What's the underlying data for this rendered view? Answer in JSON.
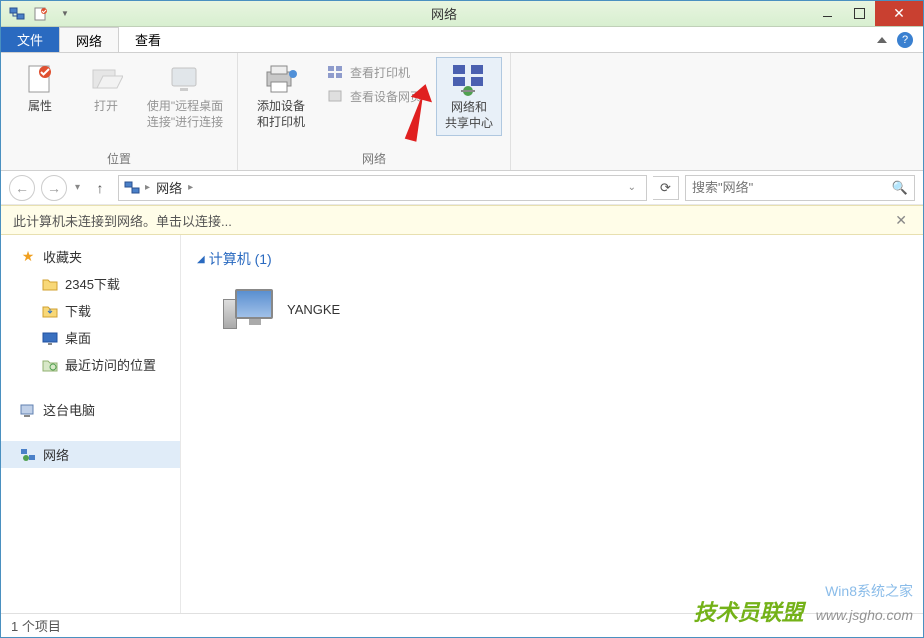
{
  "window": {
    "title": "网络",
    "close_glyph": "✕"
  },
  "tabs": {
    "file": "文件",
    "network": "网络",
    "view": "查看"
  },
  "ribbon": {
    "group_location": "位置",
    "group_network": "网络",
    "btn_properties": "属性",
    "btn_open": "打开",
    "btn_rdp_line1": "使用\"远程桌面",
    "btn_rdp_line2": "连接\"进行连接",
    "btn_add_devices_line1": "添加设备",
    "btn_add_devices_line2": "和打印机",
    "btn_view_printers": "查看打印机",
    "btn_view_device_page": "查看设备网页",
    "btn_sharing_center_line1": "网络和",
    "btn_sharing_center_line2": "共享中心"
  },
  "address": {
    "root": "网络",
    "search_placeholder": "搜索\"网络\""
  },
  "notification": {
    "text": "此计算机未连接到网络。单击以连接...",
    "close": "✕"
  },
  "sidebar": {
    "favorites": "收藏夹",
    "downloads2345": "2345下载",
    "downloads": "下载",
    "desktop": "桌面",
    "recent": "最近访问的位置",
    "thispc": "这台电脑",
    "network": "网络"
  },
  "content": {
    "group_computers": "计算机 (1)",
    "items": [
      {
        "name": "YANGKE"
      }
    ]
  },
  "status": {
    "count": "1 个项目"
  },
  "watermark": {
    "text1": "技术员联盟",
    "text2": "www.jsgho.com",
    "text3": "Win8系统之家"
  }
}
